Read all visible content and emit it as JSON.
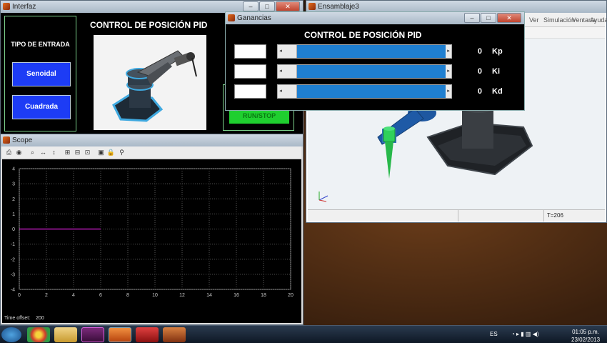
{
  "interfaz": {
    "title": "Interfaz",
    "heading": "CONTROL DE POSICIÓN PID",
    "tipo_label": "TIPO DE ENTRADA",
    "btn_senoidal": "Senoidal",
    "btn_cuadrada": "Cuadrada",
    "run_stop": "RUN/STOP"
  },
  "ganancias": {
    "title": "Ganancias",
    "heading": "CONTROL DE POSICIÓN PID",
    "gains": [
      {
        "value": "0",
        "name": "Kp"
      },
      {
        "value": "0",
        "name": "Ki"
      },
      {
        "value": "0",
        "name": "Kd"
      }
    ]
  },
  "ensamblaje": {
    "title": "Ensamblaje3",
    "menu": [
      "Ver",
      "Simulación",
      "Ventana",
      "Ayuda"
    ],
    "status_time": "T=206"
  },
  "scope": {
    "title": "Scope",
    "time_offset_label": "Time offset:",
    "time_offset_value": "200"
  },
  "chart_data": {
    "type": "line",
    "xlim": [
      0,
      20
    ],
    "ylim": [
      -4,
      4
    ],
    "x_ticks": [
      0,
      2,
      4,
      6,
      8,
      10,
      12,
      14,
      16,
      18,
      20
    ],
    "y_ticks": [
      4,
      3,
      2,
      1,
      0,
      -1,
      -2,
      -3,
      -4
    ],
    "grid": true,
    "series": [
      {
        "color": "#e020e0",
        "x": [
          0,
          6
        ],
        "y": [
          0,
          0
        ]
      }
    ]
  },
  "taskbar": {
    "lang": "ES",
    "time": "01:05 p.m.",
    "date": "23/02/2013"
  },
  "colors": {
    "accent_blue": "#1d3cf5",
    "run_green": "#1fcf2f",
    "slider_blue": "#1f7fd0",
    "trace_magenta": "#e020e0"
  }
}
